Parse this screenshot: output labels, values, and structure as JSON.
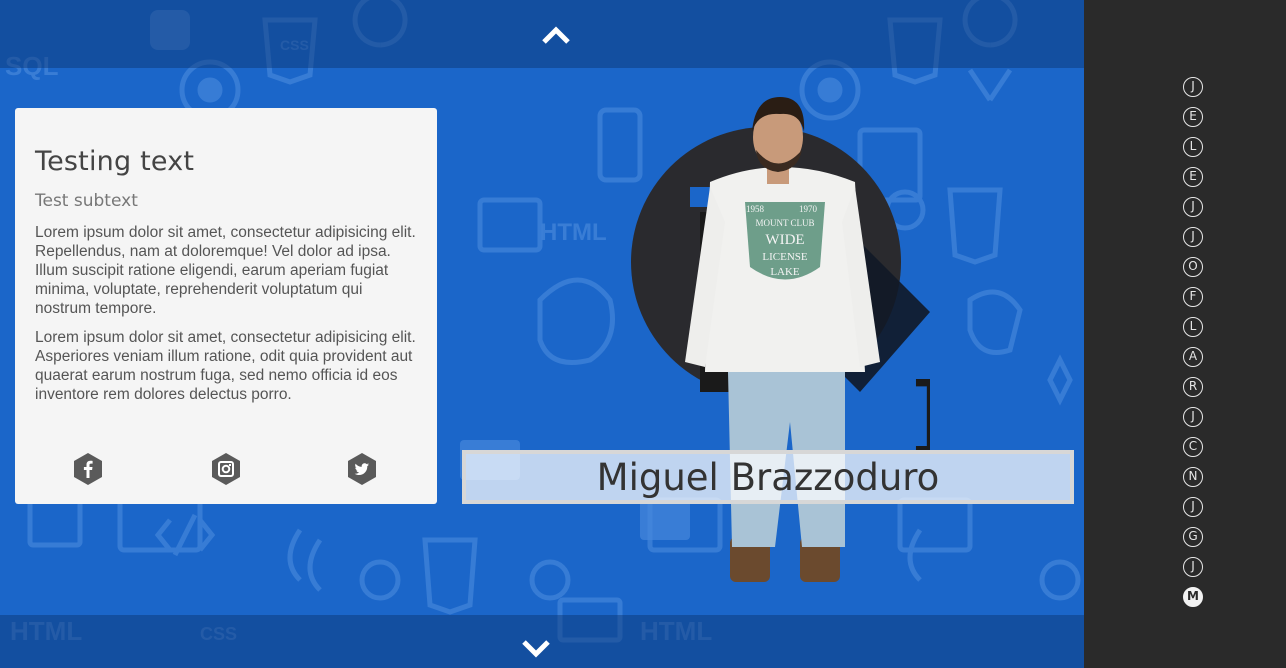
{
  "card": {
    "title": "Testing text",
    "subtitle": "Test subtext",
    "paragraph1": "Lorem ipsum dolor sit amet, consectetur adipisicing elit. Repellendus, nam at doloremque! Vel dolor ad ipsa. Illum suscipit ratione eligendi, earum aperiam fugiat minima, voluptate, reprehenderit voluptatum qui nostrum tempore.",
    "paragraph2": "Lorem ipsum dolor sit amet, consectetur adipisicing elit. Asperiores veniam illum ratione, odit quia provident aut quaerat earum nostrum fuga, sed nemo officia id eos inventore rem dolores delectus porro.",
    "socials": [
      "facebook-icon",
      "instagram-icon",
      "twitter-icon"
    ]
  },
  "profile": {
    "name": "Miguel Brazzoduro",
    "shirt_text": [
      "1958",
      "1970",
      "MOUNT CLUB",
      "WIDE",
      "LICENSE",
      "LAKE"
    ]
  },
  "background_words": [
    "SQL",
    "CSS",
    "HTML",
    "HTML",
    "CSS",
    "HTML"
  ],
  "nav": {
    "up_icon": "chevron-up-icon",
    "down_icon": "chevron-down-icon",
    "letters": [
      "J",
      "E",
      "L",
      "E",
      "J",
      "J",
      "O",
      "F",
      "L",
      "A",
      "R",
      "J",
      "C",
      "N",
      "J",
      "G",
      "J",
      "M"
    ],
    "active_index": 17
  },
  "colors": {
    "background_blue": "#1b66c9",
    "sidebar": "#2a2a2a",
    "card": "#f5f5f5"
  }
}
